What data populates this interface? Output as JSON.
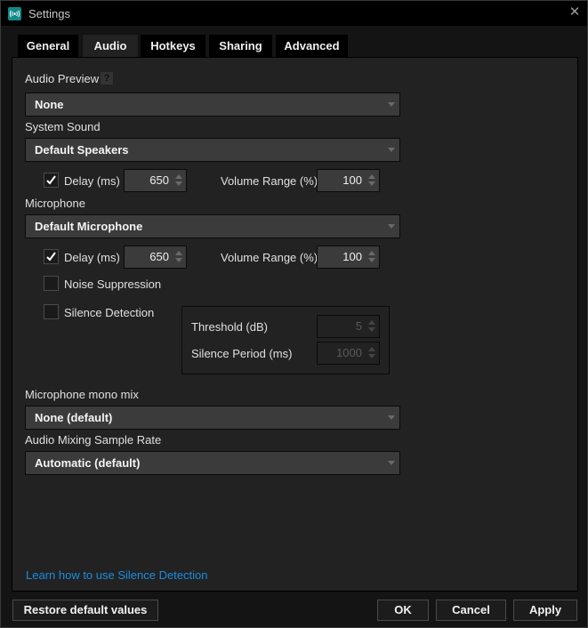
{
  "window": {
    "title": "Settings",
    "app_icon": "broadcast-icon",
    "close_icon": "close-icon",
    "close_glyph": "✕"
  },
  "tabs": [
    {
      "label": "General",
      "active": false
    },
    {
      "label": "Audio",
      "active": true
    },
    {
      "label": "Hotkeys",
      "active": false
    },
    {
      "label": "Sharing",
      "active": false
    },
    {
      "label": "Advanced",
      "active": false
    }
  ],
  "audio": {
    "audio_preview": {
      "label": "Audio Preview",
      "help_glyph": "?",
      "value": "None"
    },
    "system_sound": {
      "label": "System Sound",
      "value": "Default Speakers",
      "delay": {
        "label": "Delay (ms)",
        "checked": true,
        "value": "650"
      },
      "volume_range": {
        "label": "Volume Range (%)",
        "value": "100"
      }
    },
    "microphone": {
      "label": "Microphone",
      "value": "Default Microphone",
      "delay": {
        "label": "Delay (ms)",
        "checked": true,
        "value": "650"
      },
      "volume_range": {
        "label": "Volume Range (%)",
        "value": "100"
      },
      "noise_suppression": {
        "label": "Noise Suppression",
        "checked": false
      },
      "silence_detection": {
        "label": "Silence Detection",
        "checked": false,
        "threshold": {
          "label": "Threshold (dB)",
          "value": "5"
        },
        "silence_period": {
          "label": "Silence Period (ms)",
          "value": "1000"
        }
      }
    },
    "mono_mix": {
      "label": "Microphone mono mix",
      "value": "None (default)"
    },
    "sample_rate": {
      "label": "Audio Mixing Sample Rate",
      "value": "Automatic (default)"
    },
    "learn_link": "Learn how to use Silence Detection"
  },
  "footer": {
    "restore": "Restore default values",
    "ok": "OK",
    "cancel": "Cancel",
    "apply": "Apply"
  },
  "colors": {
    "accent_icon": "#0f8a88",
    "link": "#1b8de0",
    "panel_bg": "#222222",
    "window_bg": "#141414"
  }
}
